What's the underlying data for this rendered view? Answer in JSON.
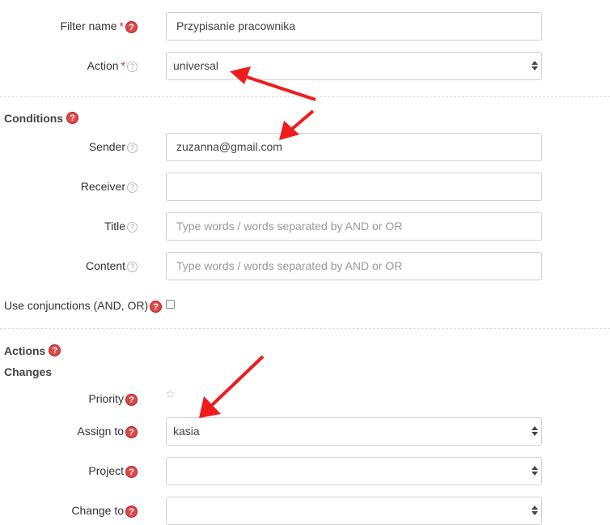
{
  "form": {
    "filter_name": {
      "label": "Filter name",
      "required_mark": "*",
      "value": "Przypisanie pracownika"
    },
    "action": {
      "label": "Action",
      "required_mark": "*",
      "value": "universal"
    }
  },
  "conditions": {
    "heading": "Conditions",
    "sender": {
      "label": "Sender",
      "value": "zuzanna@gmail.com"
    },
    "receiver": {
      "label": "Receiver",
      "value": ""
    },
    "title": {
      "label": "Title",
      "placeholder": "Type words / words separated by AND or OR"
    },
    "content": {
      "label": "Content",
      "placeholder": "Type words / words separated by AND or OR"
    },
    "use_conjunctions": {
      "label": "Use conjunctions (AND, OR)",
      "checked": false
    }
  },
  "actions": {
    "heading": "Actions",
    "changes_heading": "Changes",
    "priority": {
      "label": "Priority",
      "icon": "star-outline-icon"
    },
    "assign_to": {
      "label": "Assign to",
      "value": "kasia"
    },
    "project": {
      "label": "Project",
      "value": ""
    },
    "change_to": {
      "label": "Change to",
      "value": ""
    }
  },
  "icons": {
    "help": "?",
    "star": "☆"
  },
  "colors": {
    "required": "#e8262e",
    "help_badge": "#e04848",
    "annotation_arrow": "#ee1c1c"
  }
}
